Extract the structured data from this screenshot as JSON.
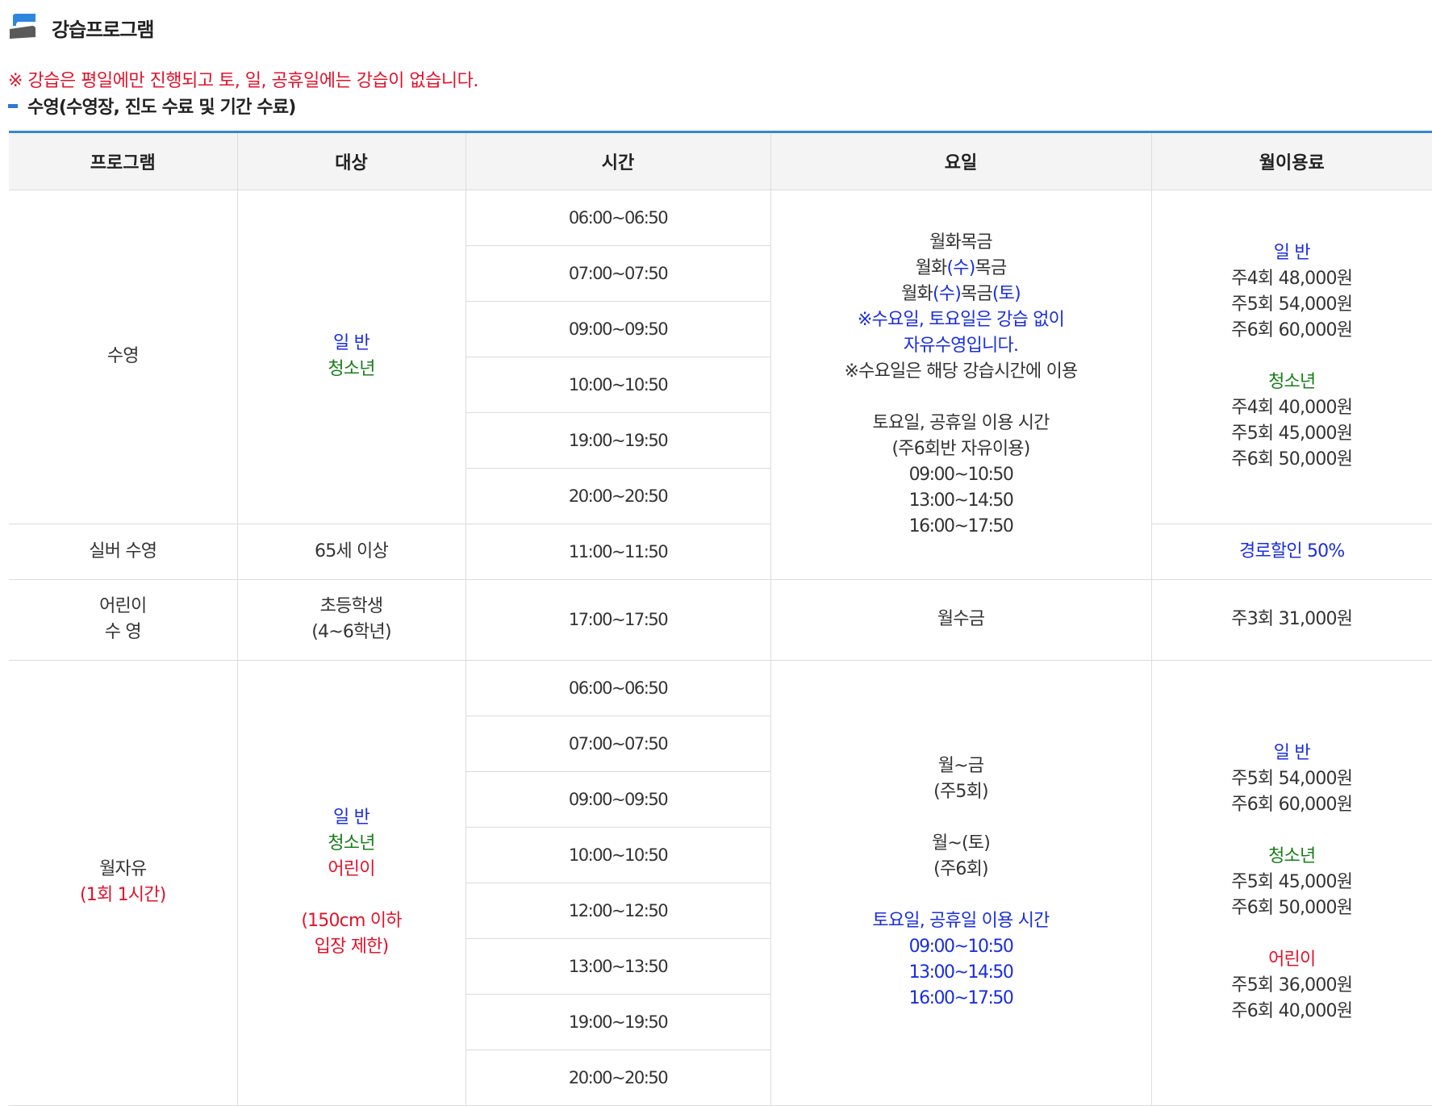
{
  "page": {
    "title": "강습프로그램",
    "notice": "※ 강습은 평일에만 진행되고 토, 일, 공휴일에는 강습이 없습니다.",
    "section": "수영(수영장, 진도 수료 및 기간 수료)"
  },
  "colors": {
    "accent_blue": "#3686d9",
    "text_blue": "#1a2ee0",
    "text_green": "#1a7d1a",
    "text_red": "#e3122a"
  },
  "table": {
    "headers": [
      "프로그램",
      "대상",
      "시간",
      "요일",
      "월이용료"
    ],
    "swim": {
      "program": "수영",
      "target_general": "일 반",
      "target_youth": "청소년",
      "times": [
        "06:00~06:50",
        "07:00~07:50",
        "09:00~09:50",
        "10:00~10:50",
        "19:00~19:50",
        "20:00~20:50"
      ],
      "days": {
        "l1": "월화목금",
        "l2_a": "월화",
        "l2_b": "(수)",
        "l2_c": "목금",
        "l3_a": "월화",
        "l3_b": "(수)",
        "l3_c": "목금",
        "l3_d": "(토)",
        "note1": "※수요일, 토요일은 강습 없이",
        "note2": "자유수영입니다.",
        "note3": "※수요일은 해당 강습시간에 이용",
        "weekend_title": "토요일, 공휴일 이용 시간",
        "weekend_sub": "(주6회반 자유이용)",
        "weekend_times": [
          "09:00~10:50",
          "13:00~14:50",
          "16:00~17:50"
        ]
      },
      "fee": {
        "general_label": "일 반",
        "general": [
          "주4회 48,000원",
          "주5회 54,000원",
          "주6회 60,000원"
        ],
        "youth_label": "청소년",
        "youth": [
          "주4회 40,000원",
          "주5회 45,000원",
          "주6회 50,000원"
        ]
      }
    },
    "silver": {
      "program": "실버 수영",
      "target": "65세 이상",
      "time": "11:00~11:50",
      "fee": "경로할인 50%"
    },
    "kids": {
      "program_l1": "어린이",
      "program_l2": "수 영",
      "target_l1": "초등학생",
      "target_l2": "(4~6학년)",
      "time": "17:00~17:50",
      "days": "월수금",
      "fee": "주3회 31,000원"
    },
    "free": {
      "program": "월자유",
      "program_sub": "(1회 1시간)",
      "target_general": "일 반",
      "target_youth": "청소년",
      "target_child": "어린이",
      "target_note1": "(150cm 이하",
      "target_note2": "입장 제한)",
      "times": [
        "06:00~06:50",
        "07:00~07:50",
        "09:00~09:50",
        "10:00~10:50",
        "12:00~12:50",
        "13:00~13:50",
        "19:00~19:50",
        "20:00~20:50"
      ],
      "days": {
        "l1": "월~금",
        "l2": "(주5회)",
        "l3": "월~(토)",
        "l4": "(주6회)",
        "weekend_title": "토요일, 공휴일 이용 시간",
        "weekend_times": [
          "09:00~10:50",
          "13:00~14:50",
          "16:00~17:50"
        ]
      },
      "fee": {
        "general_label": "일 반",
        "general": [
          "주5회 54,000원",
          "주6회 60,000원"
        ],
        "youth_label": "청소년",
        "youth": [
          "주5회 45,000원",
          "주6회 50,000원"
        ],
        "child_label": "어린이",
        "child": [
          "주5회 36,000원",
          "주6회 40,000원"
        ]
      }
    }
  }
}
